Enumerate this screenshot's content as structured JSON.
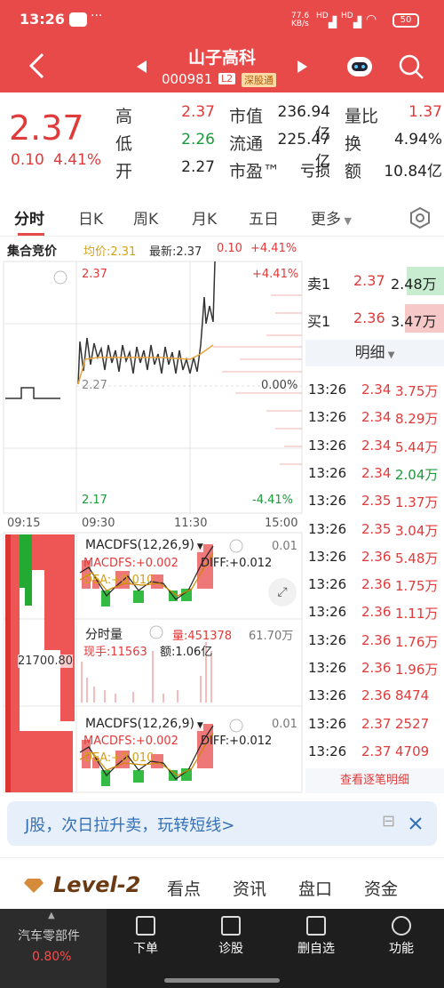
{
  "status": {
    "time": "13:26",
    "net": "77.6\nKB/s",
    "sig1": "HD",
    "sig2": "HD",
    "battery": "50"
  },
  "header": {
    "name": "山子高科",
    "code": "000981",
    "badge1": "L2",
    "badge2": "深股通"
  },
  "quote": {
    "price": "2.37",
    "change": "0.10",
    "pct": "4.41%",
    "rows": [
      {
        "l": "高",
        "v": "2.37",
        "l2": "市值",
        "v2": "236.94亿",
        "l3": "量比",
        "v3": "1.37"
      },
      {
        "l": "低",
        "v": "2.26",
        "l2": "流通",
        "v2": "225.47亿",
        "l3": "换",
        "v3": "4.94%"
      },
      {
        "l": "开",
        "v": "2.27",
        "l2": "市盈™",
        "v2": "亏损",
        "l3": "额",
        "v3": "10.84亿"
      }
    ]
  },
  "tabs": [
    "分时",
    "日K",
    "周K",
    "月K",
    "五日",
    "更多"
  ],
  "chart": {
    "auction_label": "集合竞价",
    "avg_label": "均价:2.31",
    "latest_label": "最新:2.37",
    "chg": "0.10",
    "pct": "+4.41%",
    "y_top": "2.37",
    "y_mid": "2.27",
    "y_bot": "2.17",
    "pct_top": "+4.41%",
    "pct_mid": "0.00%",
    "pct_bot": "-4.41%",
    "t0": "09:15",
    "t1": "09:30",
    "t2": "11:30",
    "t3": "15:00",
    "macd_title": "MACDFS(12,26,9)",
    "macd_val": "MACDFS:+0.002",
    "diff": "DIFF:+0.012",
    "dea": "DEA:+0.010",
    "macd_scale": "0.01",
    "vol_title": "分时量",
    "vol_amt": "量:451378",
    "vol_scale": "61.70万",
    "hand": "现手:11563",
    "amount": "额:1.06亿",
    "left_val": "21700.80"
  },
  "orderbook": {
    "sell_label": "卖1",
    "sell_price": "2.37",
    "sell_vol": "2.48万",
    "buy_label": "买1",
    "buy_price": "2.36",
    "buy_vol": "3.47万",
    "detail_label": "明细"
  },
  "trades": [
    {
      "t": "13:26",
      "p": "2.34",
      "v": "3.75万",
      "c": "red"
    },
    {
      "t": "13:26",
      "p": "2.34",
      "v": "8.29万",
      "c": "red"
    },
    {
      "t": "13:26",
      "p": "2.34",
      "v": "5.44万",
      "c": "red"
    },
    {
      "t": "13:26",
      "p": "2.34",
      "v": "2.04万",
      "c": "green"
    },
    {
      "t": "13:26",
      "p": "2.35",
      "v": "1.37万",
      "c": "red"
    },
    {
      "t": "13:26",
      "p": "2.35",
      "v": "3.04万",
      "c": "red"
    },
    {
      "t": "13:26",
      "p": "2.36",
      "v": "5.48万",
      "c": "red"
    },
    {
      "t": "13:26",
      "p": "2.36",
      "v": "1.75万",
      "c": "red"
    },
    {
      "t": "13:26",
      "p": "2.36",
      "v": "1.11万",
      "c": "red"
    },
    {
      "t": "13:26",
      "p": "2.36",
      "v": "1.76万",
      "c": "red"
    },
    {
      "t": "13:26",
      "p": "2.36",
      "v": "1.96万",
      "c": "red"
    },
    {
      "t": "13:26",
      "p": "2.36",
      "v": "8474",
      "c": "red"
    },
    {
      "t": "13:26",
      "p": "2.37",
      "v": "2527",
      "c": "red"
    },
    {
      "t": "13:26",
      "p": "2.37",
      "v": "4709",
      "c": "red"
    }
  ],
  "view_all": "查看逐笔明细",
  "banner": "J股，次日拉升卖，玩转短线>",
  "level_tabs": [
    "Level-2",
    "看点",
    "资讯",
    "盘口",
    "资金"
  ],
  "bottom_nav": {
    "sector": "汽车零部件",
    "sector_pct": "0.80%",
    "items": [
      "下单",
      "诊股",
      "删自选",
      "功能"
    ]
  },
  "colors": {
    "red": "#e84a4a",
    "green": "#1a9a3a"
  }
}
